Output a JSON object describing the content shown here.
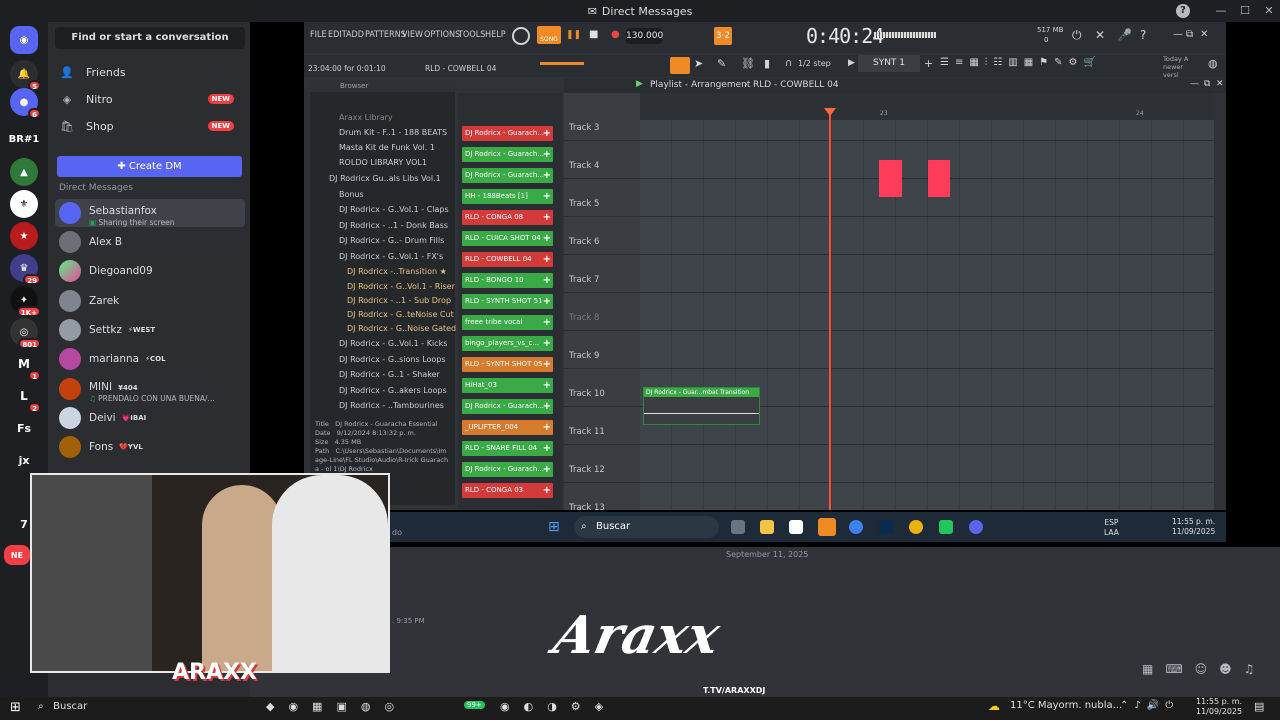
{
  "window": {
    "title": "Direct Messages"
  },
  "rail": {
    "servers": [
      {
        "label": "BR#1",
        "badge": ""
      },
      {
        "label": "",
        "badge": "6"
      },
      {
        "label": "",
        "badge": "5"
      },
      {
        "label": "",
        "badge": "29"
      },
      {
        "label": "",
        "badge": "1K+"
      },
      {
        "label": "",
        "badge": "801"
      },
      {
        "label": "M",
        "badge": "1"
      },
      {
        "label": "L",
        "badge": "2"
      },
      {
        "label": "Fs",
        "badge": ""
      },
      {
        "label": "jx",
        "badge": ""
      },
      {
        "label": "7",
        "badge": ""
      },
      {
        "label": "NE",
        "badge": ""
      }
    ]
  },
  "sidebar": {
    "search_placeholder": "Find or start a conversation",
    "nav": [
      {
        "label": "Friends",
        "badge": ""
      },
      {
        "label": "Nitro",
        "badge": "NEW"
      },
      {
        "label": "Shop",
        "badge": "NEW"
      }
    ],
    "create_dm": "Create DM",
    "dm_header": "Direct Messages",
    "dms": [
      {
        "name": "Sebastianfox",
        "status": "Sharing their screen",
        "tag": "",
        "color": "#5865f2"
      },
      {
        "name": "Alex B",
        "status": "",
        "tag": "",
        "color": "#6d6f78"
      },
      {
        "name": "Diegoand09",
        "status": "",
        "tag": "",
        "color": "#57f287"
      },
      {
        "name": "Zarek",
        "status": "",
        "tag": "",
        "color": "#80848e"
      },
      {
        "name": "Settkz",
        "status": "",
        "tag": "⚡WEST",
        "color": "#949ba4"
      },
      {
        "name": "marianna",
        "status": "",
        "tag": "⚡COL",
        "color": "#b5489f"
      },
      {
        "name": "MINI",
        "status": "PRENDALO CON UNA BUENA/...",
        "tag": "¥404",
        "color": "#c2410c"
      },
      {
        "name": "Deivi",
        "status": "",
        "tag": "💗IBAI",
        "color": "#cbd5e1"
      },
      {
        "name": "Fons",
        "status": "",
        "tag": "💔YVL",
        "color": "#a16207"
      }
    ]
  },
  "fl": {
    "menu": [
      "FILE",
      "EDIT",
      "ADD",
      "PATTERNS",
      "VIEW",
      "OPTIONS",
      "TOOLS",
      "HELP"
    ],
    "song_label": "SONG",
    "tempo": "130.000",
    "time": "0:40:24",
    "memory": "517 MB",
    "mem_sub": "0",
    "timestamp": "23:04:00 for 0:01:10",
    "channel_name": "RLD - COWBELL 04",
    "step": "1/2 step",
    "synth": "SYNT 1",
    "news": "Today A newer versi",
    "playlist_title": "Playlist - Arrangement",
    "playlist_sep": "›",
    "playlist_pattern": "RLD - COWBELL 04",
    "browser_label": "Browser",
    "browser_items": [
      "Araxx Library",
      "Drum Kit - F..1 - 188 BEATS",
      "Masta Kit de Funk Vol. 1",
      "ROLDO LIBRARY VOL1",
      "DJ Rodricx Gu..als Libs Vol.1",
      "Bonus",
      "DJ Rodricx - G..Vol.1 - Claps",
      "DJ Rodricx - ..1 - Donk Bass",
      "DJ Rodricx - G..- Drum Fills",
      "DJ Rodricx - G..Vol.1 - FX's",
      "DJ Rodricx -..Transition ★",
      "DJ Rodricx - G..Vol.1 - Riser",
      "DJ Rodricx - ..1 - Sub Drop",
      "DJ Rodricx - G..teNoise Cut",
      "DJ Rodricx - G..Noise Gated",
      "DJ Rodricx - G..Vol.1 - Kicks",
      "DJ Rodricx - G..sions Loops",
      "DJ Rodricx - G..1 - Shaker",
      "DJ Rodricx - G..akers Loops",
      "DJ Rodricx - ..Tambourines"
    ],
    "info": {
      "title_label": "Title",
      "title": "DJ Rodricx - Guaracha Essential",
      "date_label": "Date",
      "date": "9/12/2024 8:13:32 p. m.",
      "size_label": "Size",
      "size": "4.35 MB",
      "path_label": "Path",
      "path": "C:\\Users\\Sebastian\\Documents\\Image-Line\\FL Studio\\Audio\\R-Irick Guaracha - ol 1\\DJ Rodricx"
    },
    "channels": [
      {
        "label": "DJ Rodricx - Guarach...",
        "kind": "r"
      },
      {
        "label": "DJ Rodricx - Guarach...",
        "kind": "g"
      },
      {
        "label": "DJ Rodricx - Guarach...",
        "kind": "g"
      },
      {
        "label": "HH - 188Beats [1]",
        "kind": "g"
      },
      {
        "label": "RLD - CONGA 08",
        "kind": "r"
      },
      {
        "label": "RLD - CUICA SHOT 04",
        "kind": "g"
      },
      {
        "label": "RLD - COWBELL 04",
        "kind": "r"
      },
      {
        "label": "RLD - BONGO 10",
        "kind": "g"
      },
      {
        "label": "RLD - SYNTH SHOT 51",
        "kind": "g"
      },
      {
        "label": "freee tribe vocal",
        "kind": "g"
      },
      {
        "label": "bingo_players_vs_c...",
        "kind": "g"
      },
      {
        "label": "RLD - SYNTH SHOT 05",
        "kind": "o"
      },
      {
        "label": "HiHat_03",
        "kind": "g"
      },
      {
        "label": "DJ Rodricx - Guarach...",
        "kind": "g"
      },
      {
        "label": "_UPLIFTER_004",
        "kind": "o"
      },
      {
        "label": "RLD - SNARE FILL 04",
        "kind": "g"
      },
      {
        "label": "DJ Rodricx - Guarach...",
        "kind": "g"
      },
      {
        "label": "RLD - CONGA 03",
        "kind": "r"
      }
    ],
    "tracks": [
      "Track 3",
      "Track 4",
      "Track 5",
      "Track 6",
      "Track 7",
      "Track 8",
      "Track 9",
      "Track 10",
      "Track 11",
      "Track 12",
      "Track 13"
    ],
    "bar_numbers": [
      "23",
      "24"
    ],
    "clip_label": "DJ Rodricx - Guar...mbat Transition"
  },
  "inner_taskbar": {
    "search": "Buscar",
    "lang": "ESP",
    "lang_sub": "LAA",
    "time": "11:55 p. m.",
    "date": "11/09/2025"
  },
  "chat": {
    "date_separator": "September 11, 2025",
    "msg_time": ". 9:35 PM",
    "trailing": "do"
  },
  "overlay": {
    "logo": "Araxx",
    "channel": "T.TV/ARAXXDJ",
    "webcam_brand": "ARAXX"
  },
  "taskbar": {
    "search": "Buscar",
    "weather": "11°C  Mayorm. nubla...",
    "time": "11:55 p. m.",
    "date": "11/09/2025",
    "badge": "99+"
  }
}
